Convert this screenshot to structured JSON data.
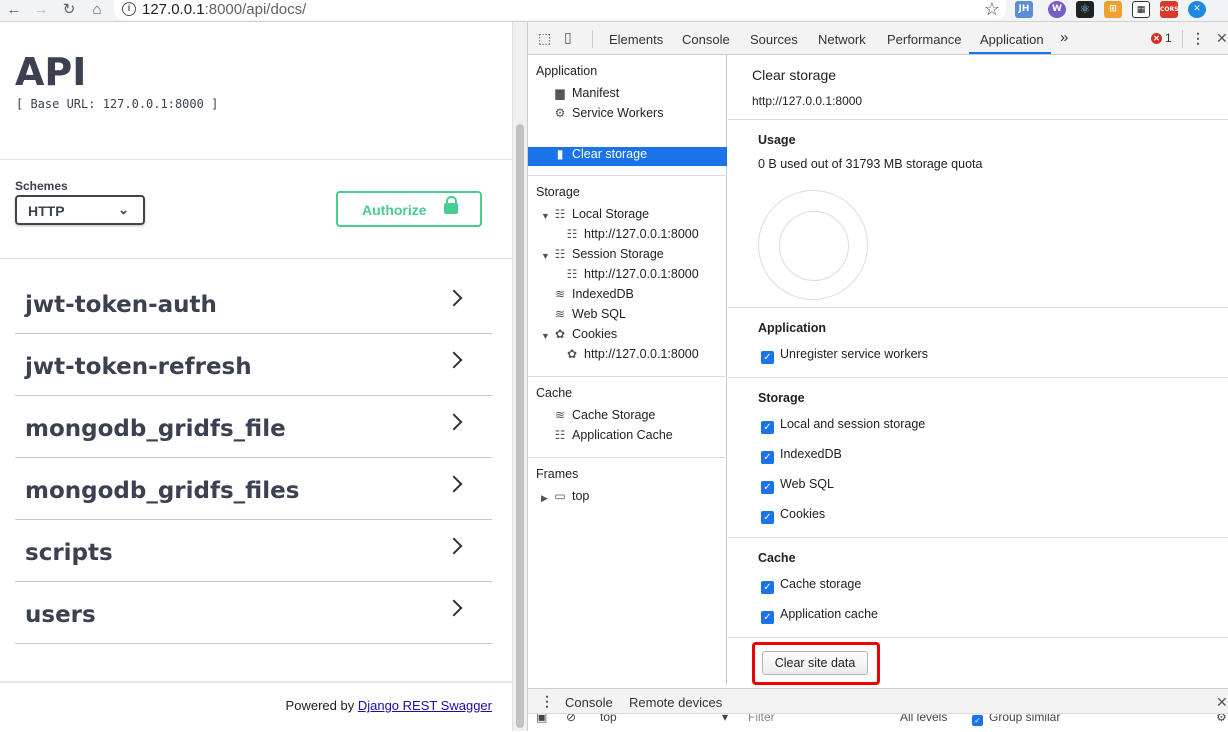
{
  "browser": {
    "url_host": "127.0.0.1",
    "url_rest": ":8000/api/docs/"
  },
  "swagger": {
    "title": "API",
    "base_url": "[ Base URL: 127.0.0.1:8000 ]",
    "schemes_label": "Schemes",
    "scheme_value": "HTTP",
    "authorize_label": "Authorize",
    "operations": [
      "jwt-token-auth",
      "jwt-token-refresh",
      "mongodb_gridfs_file",
      "mongodb_gridfs_files",
      "scripts",
      "users"
    ],
    "powered_by": "Powered by",
    "powered_link": "Django REST Swagger"
  },
  "devtools": {
    "tabs": [
      "Elements",
      "Console",
      "Sources",
      "Network",
      "Performance",
      "Application"
    ],
    "active_tab": "Application",
    "more_tabs": "»",
    "error_count": "1",
    "sidebar": {
      "application_header": "Application",
      "manifest": "Manifest",
      "service_workers": "Service Workers",
      "clear_storage": "Clear storage",
      "storage_header": "Storage",
      "local_storage": "Local Storage",
      "local_storage_origin": "http://127.0.0.1:8000",
      "session_storage": "Session Storage",
      "session_storage_origin": "http://127.0.0.1:8000",
      "indexeddb": "IndexedDB",
      "websql": "Web SQL",
      "cookies": "Cookies",
      "cookies_origin": "http://127.0.0.1:8000",
      "cache_header": "Cache",
      "cache_storage": "Cache Storage",
      "application_cache": "Application Cache",
      "frames_header": "Frames",
      "frames_top": "top"
    },
    "main": {
      "title": "Clear storage",
      "origin": "http://127.0.0.1:8000",
      "usage_header": "Usage",
      "usage_text": "0 B used out of 31793 MB storage quota",
      "application_header": "Application",
      "unregister_sw": "Unregister service workers",
      "storage_header": "Storage",
      "local_session": "Local and session storage",
      "indexeddb": "IndexedDB",
      "websql": "Web SQL",
      "cookies": "Cookies",
      "cache_header": "Cache",
      "cache_storage": "Cache storage",
      "application_cache": "Application cache",
      "clear_button": "Clear site data"
    },
    "drawer": {
      "console_tab": "Console",
      "remote_tab": "Remote devices",
      "context": "top",
      "filter_placeholder": "Filter",
      "levels": "All levels",
      "group_similar": "Group similar"
    }
  }
}
